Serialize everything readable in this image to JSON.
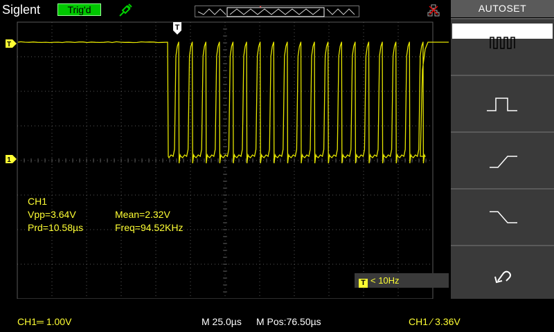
{
  "brand": "Siglent",
  "trigger_status": "Trig'd",
  "menu": {
    "title": "AUTOSET",
    "options": [
      {
        "icon": "multi-pulse-icon"
      },
      {
        "icon": "single-pulse-icon"
      },
      {
        "icon": "rising-edge-icon"
      },
      {
        "icon": "falling-edge-icon"
      },
      {
        "icon": "undo-icon"
      }
    ]
  },
  "measurements": {
    "channel": "CH1",
    "vpp": "Vpp=3.64V",
    "mean": "Mean=2.32V",
    "prd": "Prd=10.58µs",
    "freq": "Freq=94.52KHz"
  },
  "freq_counter": {
    "icon_label": "T",
    "value": "< 10Hz"
  },
  "markers": {
    "trigger_pos": "T",
    "trigger_level": "T",
    "channel1_ground": "1"
  },
  "status_bar": {
    "ch1_scale": "CH1═ 1.00V",
    "timebase": "M 25.0µs",
    "mpos": "M Pos:76.50µs",
    "trigger": "CH1 ∕ 3.36V"
  },
  "colors": {
    "trace": "#e6e600",
    "grid": "#5a5a5a",
    "accent": "#ffff33",
    "menu_bg": "#3a3a3a"
  }
}
